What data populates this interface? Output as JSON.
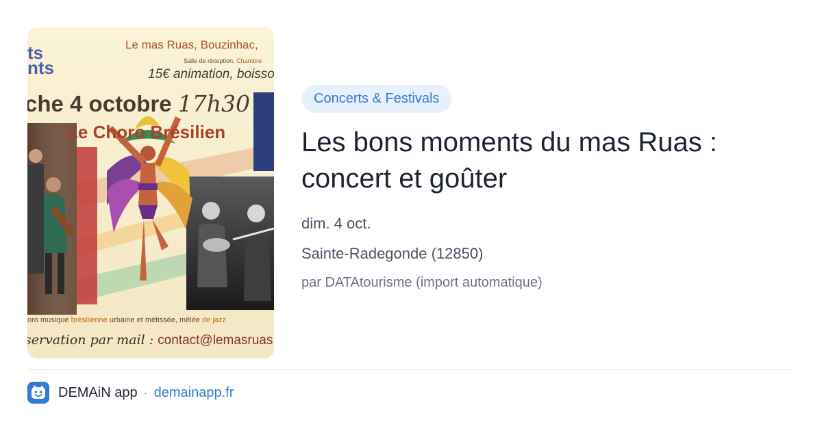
{
  "poster": {
    "venue": "Le mas Ruas, Bouzinhac, ",
    "logo_lines": "ts\nnts",
    "salle_a": "Salle de réception, ",
    "salle_b": "Chambre",
    "price": "15€ animation, boisso",
    "date_a": "che 4 octobre ",
    "date_b": "17h30",
    "band": "Le Choro Brésilien",
    "desc_a": "oro musique ",
    "desc_b": "brésilienne",
    "desc_c": " urbaine et métissée, mêlée ",
    "desc_d": "de jazz",
    "mail_a": "servation par mail : ",
    "mail_b": "contact@lemasruas"
  },
  "event": {
    "category": "Concerts & Festivals",
    "title": "Les bons moments du mas Ruas : concert et goûter",
    "date": "dim. 4 oct.",
    "place": "Sainte-Radegonde (12850)",
    "source": "par DATAtourisme (import automatique)"
  },
  "footer": {
    "app_name": "DEMAiN app",
    "separator": "·",
    "link": "demainapp.fr",
    "icon": "smiling-face-icon"
  },
  "colors": {
    "accent": "#2f7bd6",
    "badge_bg": "#e8f1fb",
    "title": "#1d2333",
    "muted": "#4a5263"
  }
}
